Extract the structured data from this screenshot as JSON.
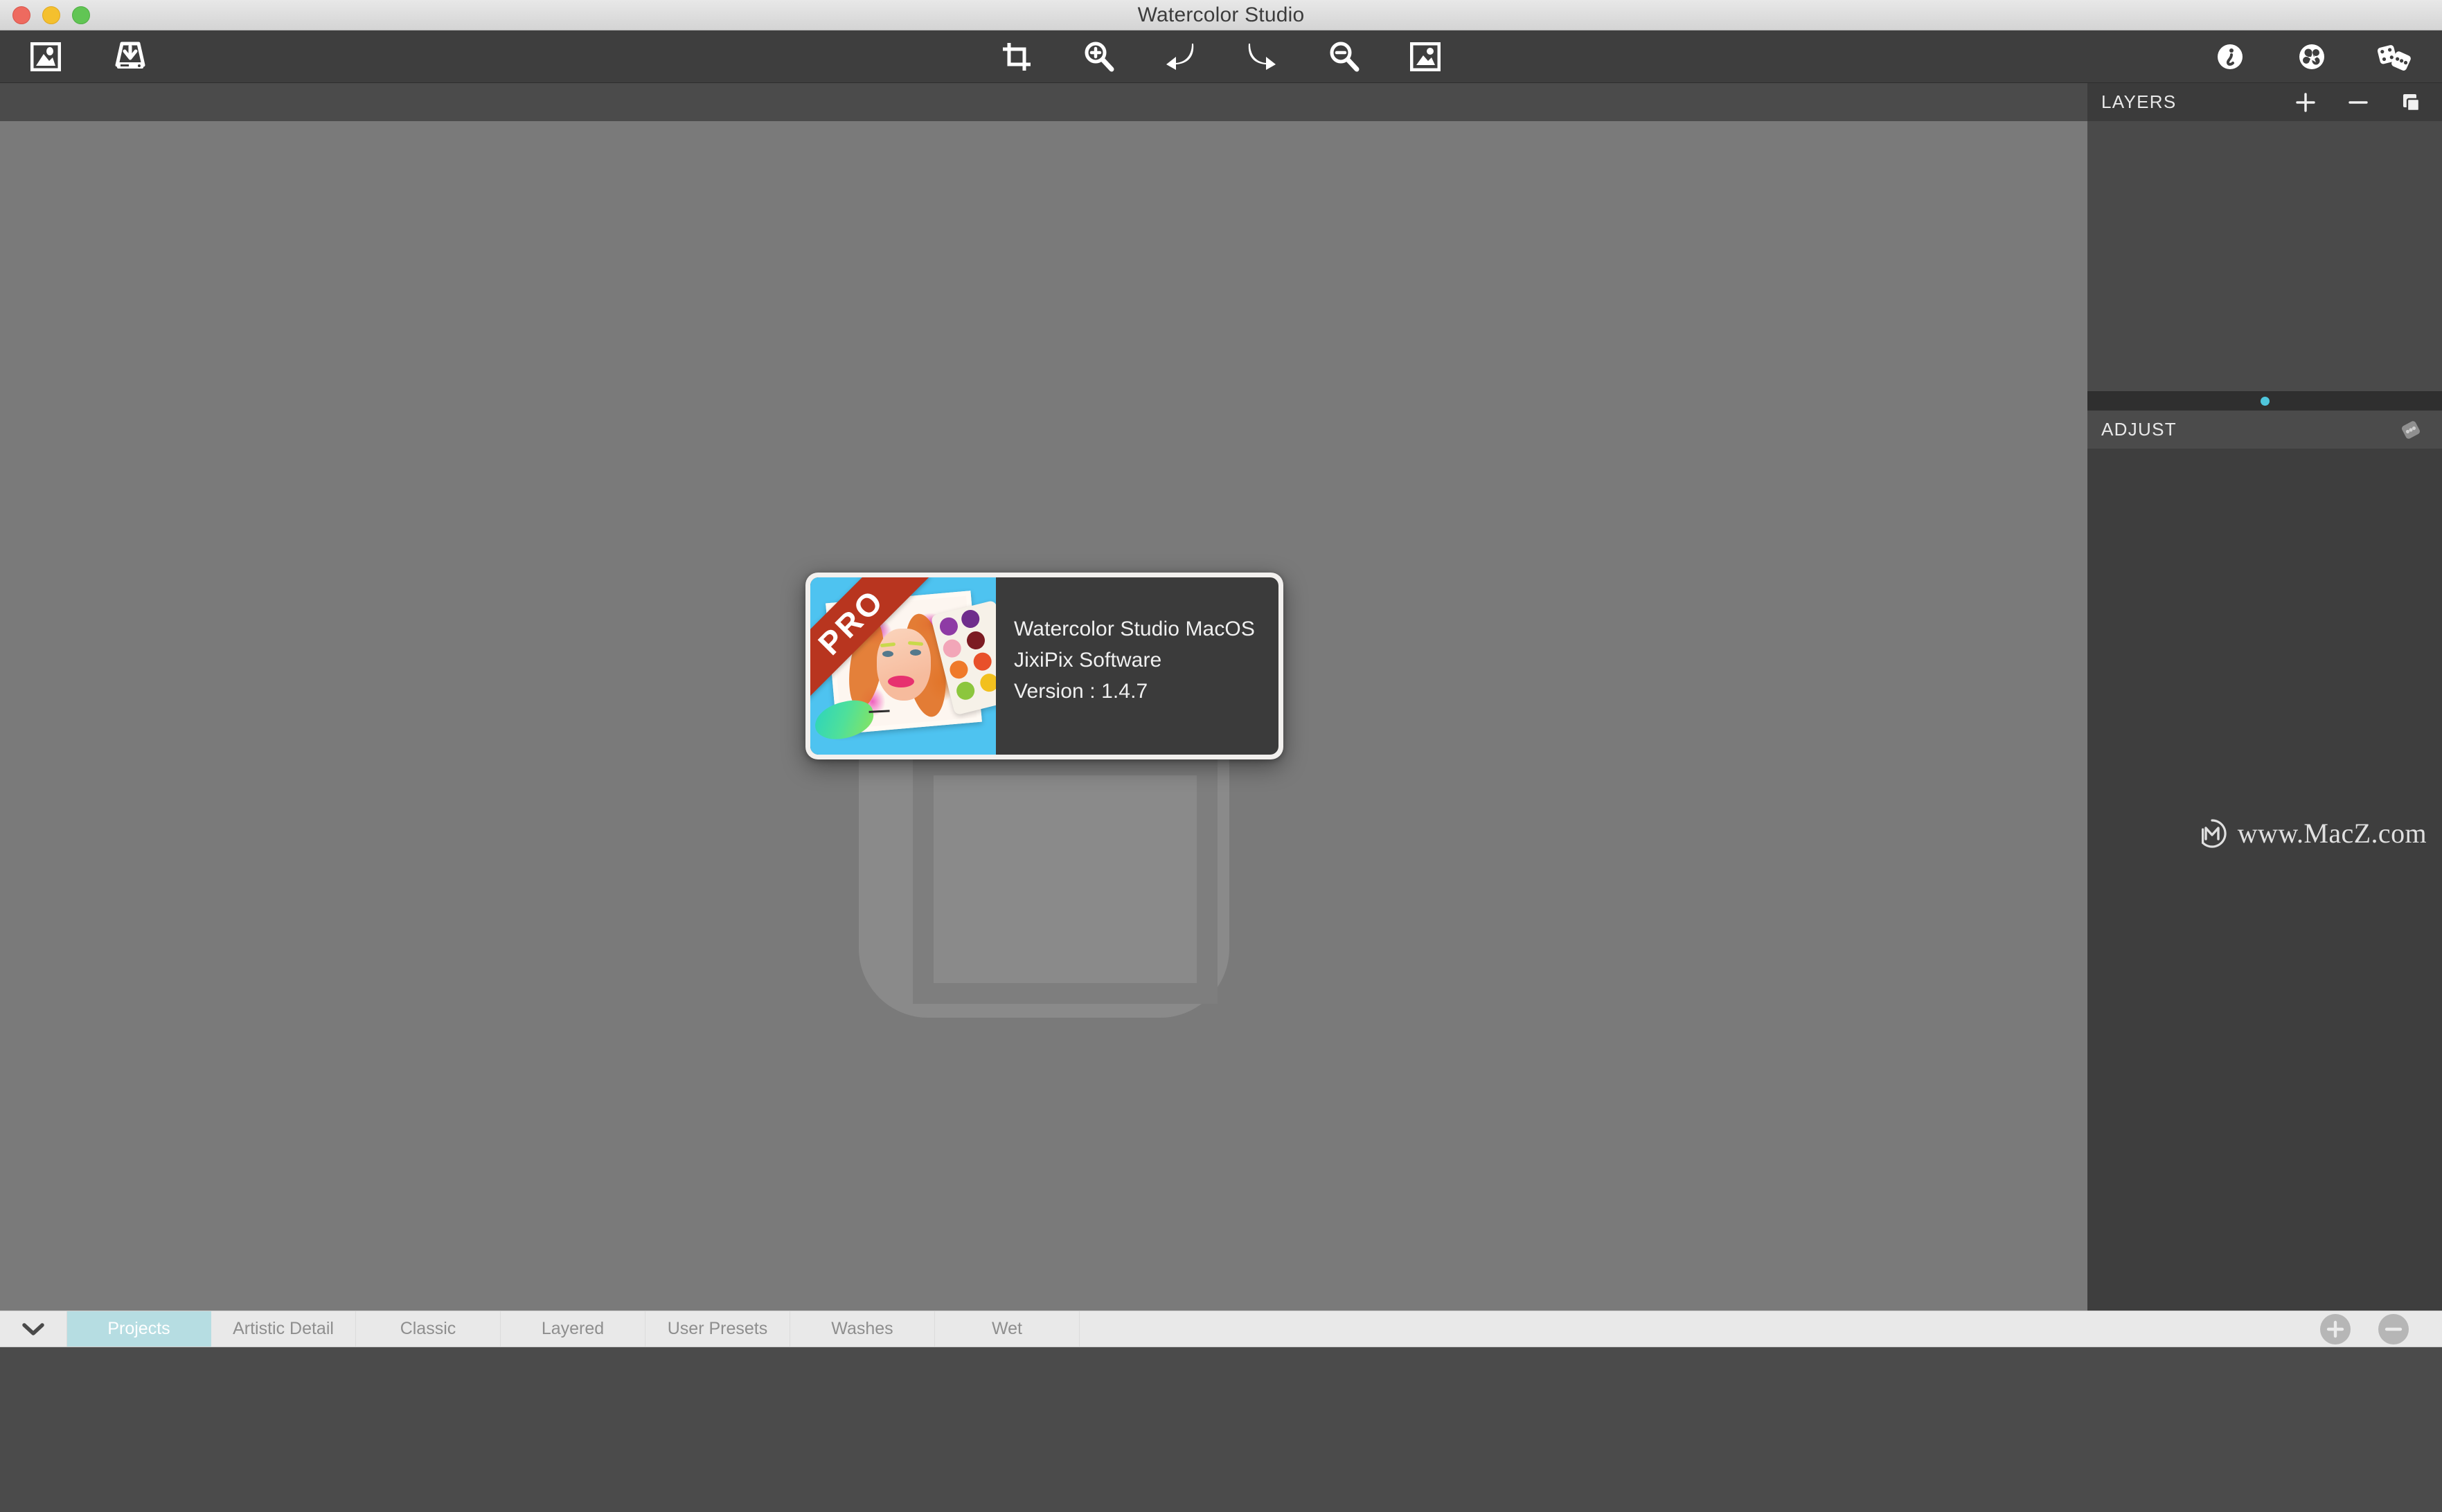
{
  "window": {
    "title": "Watercolor Studio",
    "traffic_lights": [
      "close-button",
      "minimize-button",
      "maximize-button"
    ]
  },
  "toolbar": {
    "left_tools": [
      {
        "name": "open-image-icon",
        "label": "Open Image"
      },
      {
        "name": "save-image-icon",
        "label": "Save Image"
      }
    ],
    "center_tools": [
      {
        "name": "crop-icon",
        "label": "Crop"
      },
      {
        "name": "zoom-in-icon",
        "label": "Zoom In"
      },
      {
        "name": "undo-icon",
        "label": "Undo"
      },
      {
        "name": "redo-icon",
        "label": "Redo"
      },
      {
        "name": "zoom-out-icon",
        "label": "Zoom Out"
      },
      {
        "name": "fit-image-icon",
        "label": "Fit Image"
      }
    ],
    "right_tools": [
      {
        "name": "info-icon",
        "label": "Info"
      },
      {
        "name": "splat-icon",
        "label": "Effects"
      },
      {
        "name": "dice-icon",
        "label": "Randomize"
      }
    ]
  },
  "canvas": {
    "placeholder": "drop-image-placeholder"
  },
  "about_dialog": {
    "app_name": "Watercolor Studio MacOS",
    "company": "JixiPix Software",
    "version": "Version : 1.4.7",
    "badge": "PRO"
  },
  "layers_panel": {
    "title": "LAYERS",
    "collapse_icon": "chevron-right-icon",
    "actions": [
      {
        "name": "add-layer-button",
        "glyph": "+"
      },
      {
        "name": "remove-layer-button",
        "glyph": "−"
      },
      {
        "name": "duplicate-layer-button",
        "glyph": "copy"
      }
    ]
  },
  "adjust_panel": {
    "title": "ADJUST",
    "dice_icon": "dice-icon"
  },
  "watermark": {
    "text": "www.MacZ.com",
    "logo": "m-circle-logo"
  },
  "tabbar": {
    "collapse_icon": "chevron-down-icon",
    "tabs": [
      {
        "label": "Projects",
        "active": true
      },
      {
        "label": "Artistic Detail",
        "active": false
      },
      {
        "label": "Classic",
        "active": false
      },
      {
        "label": "Layered",
        "active": false
      },
      {
        "label": "User Presets",
        "active": false
      },
      {
        "label": "Washes",
        "active": false
      },
      {
        "label": "Wet",
        "active": false
      }
    ],
    "actions": [
      {
        "name": "add-preset-button",
        "glyph": "+"
      },
      {
        "name": "remove-preset-button",
        "glyph": "−"
      }
    ]
  },
  "colors": {
    "titlebar": "#e0e0e0",
    "toolbar": "#3e3e3e",
    "canvas": "#7a7a7a",
    "panel": "#3e3e3e",
    "accent_cyan": "#4fc6dc",
    "tab_active": "#b6dde2",
    "pro_red": "#b8351f"
  }
}
